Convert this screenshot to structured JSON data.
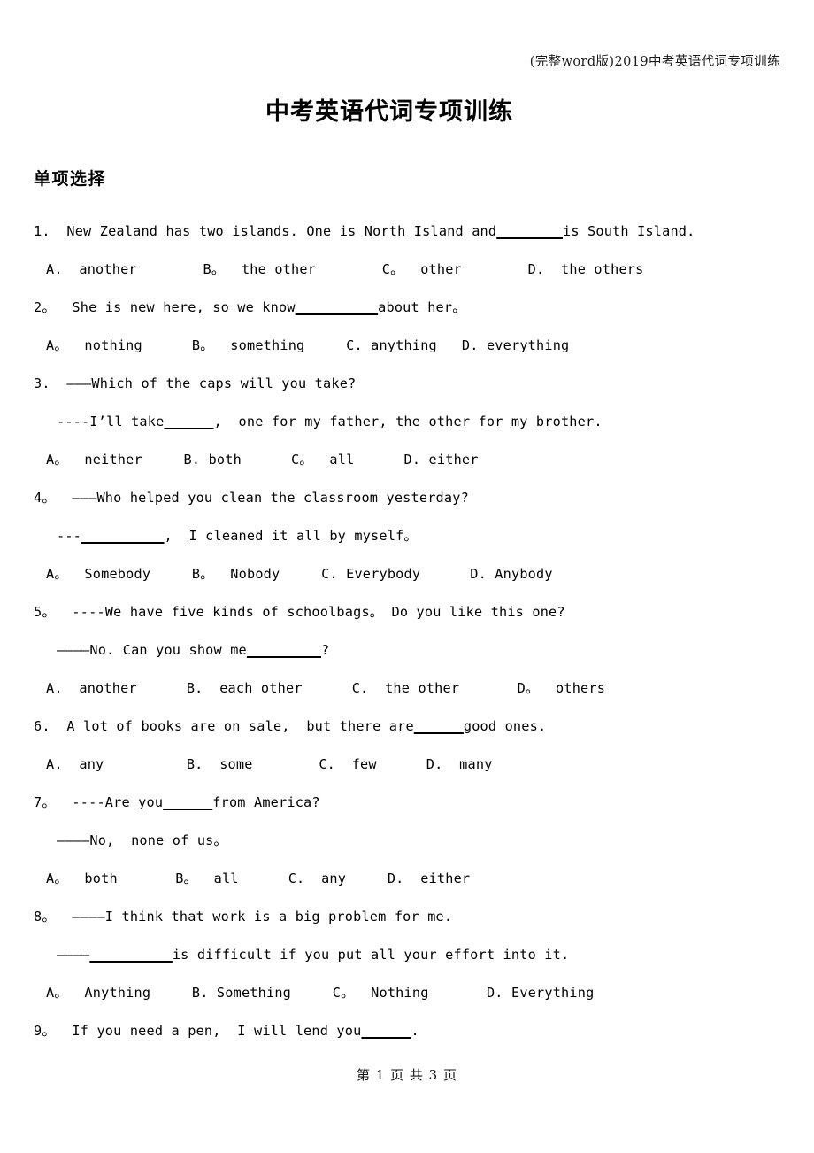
{
  "header": {
    "running_head": "(完整word版)2019中考英语代词专项训练"
  },
  "title": "中考英语代词专项训练",
  "section": {
    "heading": "单项选择"
  },
  "questions": [
    {
      "number": "1.",
      "stem_before": "1.  New Zealand has two islands. One is North Island and",
      "blank": "________",
      "stem_after": "is South Island.",
      "options": "A.  another        B。  the other        C。  other        D.  the others"
    },
    {
      "number": "2。",
      "stem_before": "2。  She is new here, so we know",
      "blank": "__________",
      "stem_after": "about her。",
      "options": "A。  nothing      B。  something     C. anything   D. everything"
    },
    {
      "number": "3.",
      "stem_before": "3.  ———Which of the caps will you take?",
      "blank": "",
      "stem_after": "",
      "continuation_before": "----I’ll take",
      "continuation_blank": "______",
      "continuation_after": ",  one for my father, the other for my brother.",
      "options": "A。  neither     B. both      C。  all      D. either"
    },
    {
      "number": "4。",
      "stem_before": "4。  ———Who helped you clean the classroom yesterday?",
      "blank": "",
      "stem_after": "",
      "continuation_before": "---",
      "continuation_blank": "__________",
      "continuation_after": ",  I cleaned it all by myself。",
      "options": "A。  Somebody     B。  Nobody     C. Everybody      D. Anybody"
    },
    {
      "number": "5。",
      "stem_before": "5。  ----We have five kinds of schoolbags。 Do you like this one?",
      "blank": "",
      "stem_after": "",
      "continuation_before": "————No. Can you show me",
      "continuation_blank": "_________",
      "continuation_after": "?",
      "options": "A.  another      B.  each other      C.  the other       D。  others"
    },
    {
      "number": "6.",
      "stem_before": "6.  A lot of books are on sale,  but there are",
      "blank": "______",
      "stem_after": "good ones.",
      "options": "A.  any          B.  some        C.  few      D.  many"
    },
    {
      "number": "7。",
      "stem_before": "7。  ----Are you",
      "blank": "______",
      "stem_after": "from America?",
      "continuation_before": "————No,  none of us。",
      "continuation_blank": "",
      "continuation_after": "",
      "options": "A。  both       B。  all      C.  any     D.  either"
    },
    {
      "number": "8。",
      "stem_before": "8。  ————I think that work is a big problem for me.",
      "blank": "",
      "stem_after": "",
      "continuation_before": "————",
      "continuation_blank": "__________",
      "continuation_after": "is difficult if you put all your effort into it.",
      "options": "A。  Anything     B. Something     C。  Nothing       D. Everything"
    },
    {
      "number": "9。",
      "stem_before": "9。  If you need a pen,  I will lend you",
      "blank": "______",
      "stem_after": ".",
      "options": ""
    }
  ],
  "footer": {
    "page_label": "第 1 页 共 3 页"
  }
}
